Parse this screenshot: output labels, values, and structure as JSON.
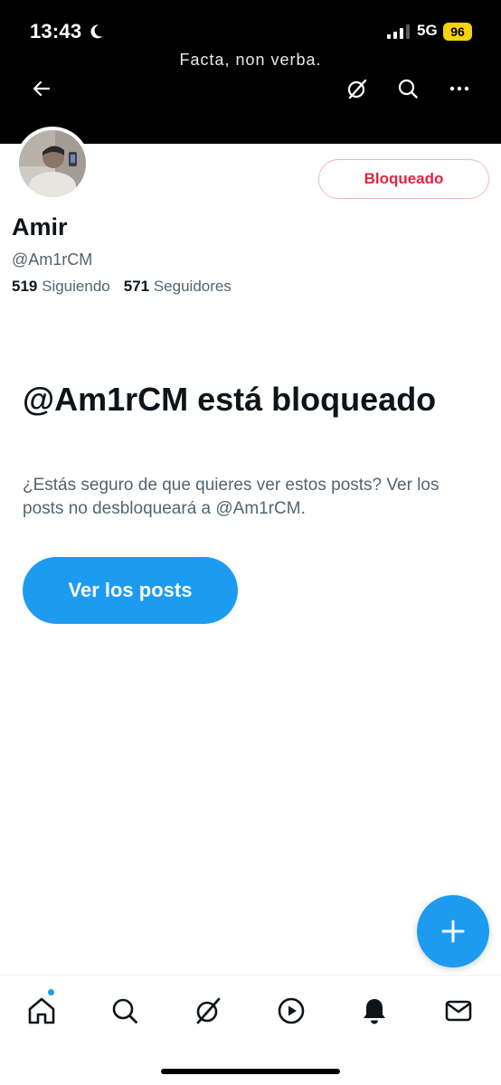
{
  "status_bar": {
    "time": "13:43",
    "network": "5G",
    "battery": "96",
    "moon_icon": "moon-icon",
    "signal_icon": "cellular-signal-icon"
  },
  "header": {
    "banner_text": "Facta, non verba.",
    "back_icon": "arrow-left-icon",
    "grok_icon": "grok-icon",
    "search_icon": "search-icon",
    "more_icon": "more-horizontal-icon"
  },
  "profile": {
    "name": "Amir",
    "handle": "@Am1rCM",
    "following_count": "519",
    "following_label": "Siguiendo",
    "followers_count": "571",
    "followers_label": "Seguidores",
    "blocked_button_label": "Bloqueado"
  },
  "blocked_notice": {
    "title": "@Am1rCM está bloqueado",
    "description": "¿Estás seguro de que quieres ver estos posts? Ver los posts no desbloqueará a @Am1rCM.",
    "view_button_label": "Ver los posts"
  },
  "fab": {
    "icon": "plus-icon"
  },
  "tabbar": {
    "tabs": [
      {
        "name": "home",
        "icon": "home-icon"
      },
      {
        "name": "search",
        "icon": "search-icon"
      },
      {
        "name": "grok",
        "icon": "grok-icon"
      },
      {
        "name": "video",
        "icon": "play-circle-icon"
      },
      {
        "name": "notifications",
        "icon": "bell-icon"
      },
      {
        "name": "messages",
        "icon": "envelope-icon"
      }
    ]
  },
  "colors": {
    "accent": "#1d9bf0",
    "blocked_red": "#e0243d",
    "text_primary": "#0f1419",
    "text_secondary": "#536471",
    "banner": "#000000",
    "battery": "#f5d20d"
  }
}
